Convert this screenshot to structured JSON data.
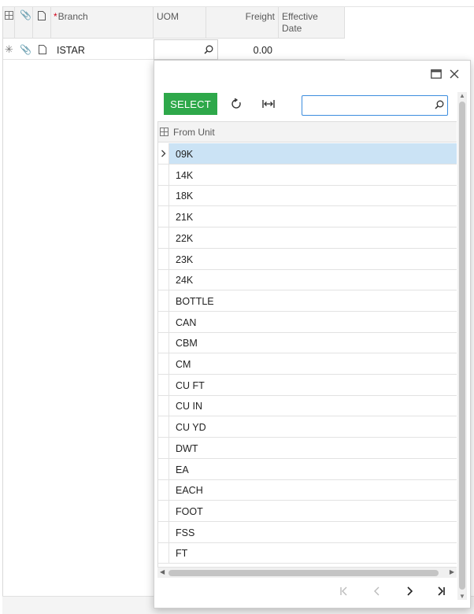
{
  "grid": {
    "columns": {
      "branch": "Branch",
      "uom": "UOM",
      "freight": "Freight",
      "effective_date_line1": "Effective",
      "effective_date_line2": "Date"
    },
    "row": {
      "branch": "ISTAR",
      "uom": "",
      "freight": "0.00"
    }
  },
  "popup": {
    "toolbar": {
      "select_label": "SELECT",
      "search_value": ""
    },
    "list": {
      "header": "From Unit",
      "items": [
        "09K",
        "14K",
        "18K",
        "21K",
        "22K",
        "23K",
        "24K",
        "BOTTLE",
        "CAN",
        "CBM",
        "CM",
        "CU FT",
        "CU IN",
        "CU YD",
        "DWT",
        "EA",
        "EACH",
        "FOOT",
        "FSS",
        "FT"
      ],
      "selected_index": 0
    }
  },
  "colors": {
    "accent_green": "#2ea84a",
    "selected_row": "#cbe3f5",
    "focus_border": "#3c8dde",
    "required_star": "#d0021b"
  }
}
